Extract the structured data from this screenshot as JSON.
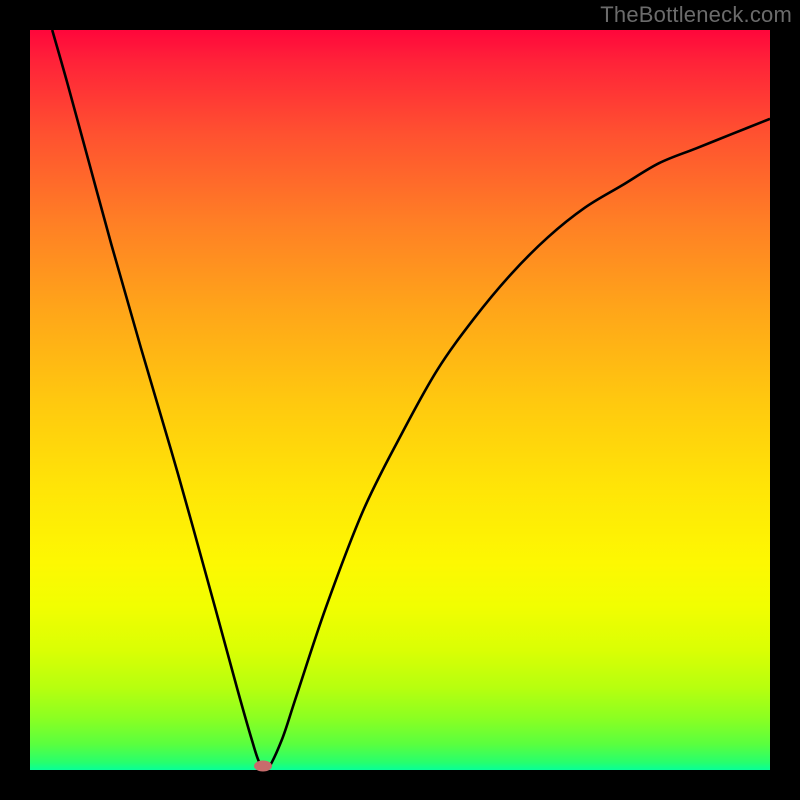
{
  "watermark": "TheBottleneck.com",
  "chart_data": {
    "type": "line",
    "title": "",
    "xlabel": "",
    "ylabel": "",
    "xlim": [
      0,
      100
    ],
    "ylim": [
      0,
      100
    ],
    "grid": false,
    "legend": false,
    "series": [
      {
        "name": "bottleneck-curve",
        "x": [
          3,
          5,
          8,
          11,
          15,
          20,
          25,
          28,
          30,
          31,
          32,
          34,
          36,
          40,
          45,
          50,
          55,
          60,
          65,
          70,
          75,
          80,
          85,
          90,
          95,
          100
        ],
        "y": [
          100,
          93,
          82,
          71,
          57,
          40,
          22,
          11,
          4,
          1,
          0,
          4,
          10,
          22,
          35,
          45,
          54,
          61,
          67,
          72,
          76,
          79,
          82,
          84,
          86,
          88
        ]
      }
    ],
    "marker": {
      "x": 31.5,
      "y": 0.5,
      "color": "#c76c6c"
    },
    "background_gradient": {
      "direction": "vertical",
      "stops": [
        {
          "pos": 0.0,
          "color": "#ff063b"
        },
        {
          "pos": 0.5,
          "color": "#ffc80f"
        },
        {
          "pos": 0.78,
          "color": "#f1fe01"
        },
        {
          "pos": 1.0,
          "color": "#08ff99"
        }
      ]
    },
    "curve_color": "#000000"
  }
}
